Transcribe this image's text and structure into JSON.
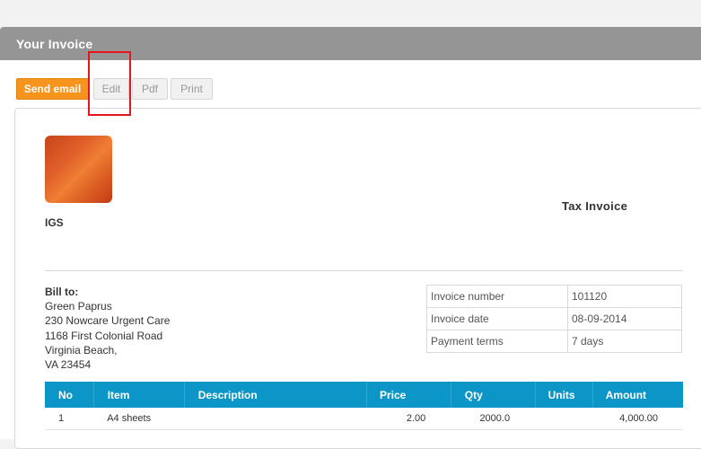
{
  "window": {
    "title": "Your Invoice"
  },
  "toolbar": {
    "send_email": "Send email",
    "edit": "Edit",
    "pdf": "Pdf",
    "print": "Print"
  },
  "invoice": {
    "company": "IGS",
    "doc_type": "Tax Invoice",
    "bill_to": {
      "label": "Bill to:",
      "lines": [
        "Green Paprus",
        "230 Nowcare Urgent Care",
        "1168 First Colonial Road",
        "Virginia Beach,",
        "VA 23454"
      ]
    },
    "meta": [
      {
        "label": "Invoice number",
        "value": "101120"
      },
      {
        "label": "Invoice date",
        "value": "08-09-2014"
      },
      {
        "label": "Payment terms",
        "value": "7 days"
      }
    ],
    "table": {
      "columns": [
        "No",
        "Item",
        "Description",
        "Price",
        "Qty",
        "Units",
        "Amount"
      ],
      "rows": [
        {
          "no": "1",
          "item": "A4 sheets",
          "description": "",
          "price": "2.00",
          "qty": "2000.0",
          "units": "",
          "amount": "4,000.00"
        }
      ]
    }
  },
  "colors": {
    "accent": "#f7941d",
    "header": "#0c96c8",
    "titlebar": "#959595",
    "highlight": "#e8141b"
  }
}
